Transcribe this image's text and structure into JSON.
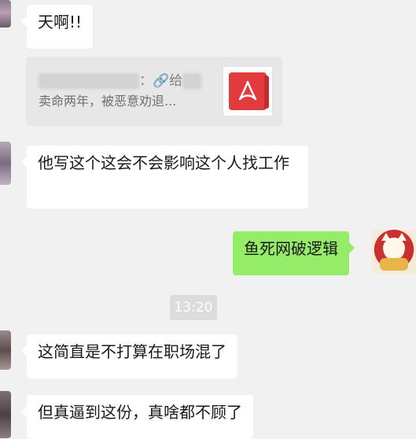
{
  "messages": [
    {
      "text": "天啊!!"
    },
    {
      "text": "他写这个这会不会影响这个人找工作"
    },
    {
      "text": "鱼死网破逻辑"
    },
    {
      "text": "这简直是不打算在职场混了"
    },
    {
      "text": "但真逼到这份，真啥都不顾了"
    }
  ],
  "card": {
    "title_suffix": "：🔗给",
    "description": "卖命两年，被恶意劝退...",
    "thumb_icon": "pdf-file-icon",
    "thumb_color": "#e13b3e"
  },
  "timestamp": "13:20",
  "colors": {
    "background": "#f1f1f1",
    "incoming_bubble": "#ffffff",
    "outgoing_bubble": "#95ec69",
    "card": "#e7e7e7",
    "time_badge": "#dcdcdc"
  }
}
